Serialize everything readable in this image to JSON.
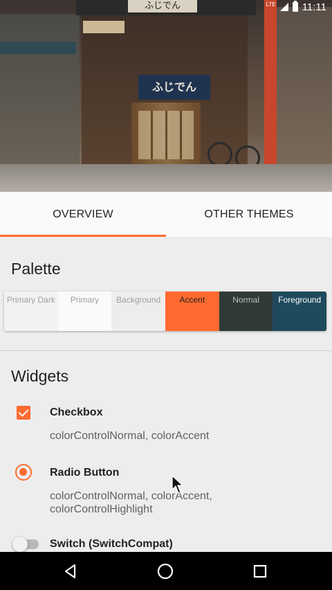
{
  "status_bar": {
    "network": "LTE",
    "time": "11:11"
  },
  "hero": {
    "shop_sign": "ふじでん",
    "noren_text": "ふじでん"
  },
  "tabs": [
    {
      "label": "OVERVIEW",
      "active": true
    },
    {
      "label": "OTHER THEMES",
      "active": false
    }
  ],
  "palette": {
    "title": "Palette",
    "swatches": [
      {
        "label": "Primary Dark",
        "bg": "#f2f2f2",
        "fg": "#9e9e9e"
      },
      {
        "label": "Primary",
        "bg": "#fafafa",
        "fg": "#9e9e9e"
      },
      {
        "label": "Background",
        "bg": "#ededed",
        "fg": "#9e9e9e"
      },
      {
        "label": "Accent",
        "bg": "#ff6a30",
        "fg": "#212121"
      },
      {
        "label": "Normal",
        "bg": "#2f3a38",
        "fg": "#bdbdbd"
      },
      {
        "label": "Foreground",
        "bg": "#1f4a5e",
        "fg": "#ffffff"
      }
    ]
  },
  "widgets": {
    "title": "Widgets",
    "checkbox": {
      "label": "Checkbox",
      "desc": "colorControlNormal, colorAccent",
      "checked": true
    },
    "radio": {
      "label": "Radio Button",
      "desc": "colorControlNormal, colorAccent, colorControlHighlight",
      "selected": true
    },
    "switch": {
      "label": "Switch (SwitchCompat)",
      "on": false
    }
  },
  "colors": {
    "accent": "#ff6a30"
  },
  "navbar": {
    "back": "back-icon",
    "home": "home-icon",
    "recents": "recents-icon"
  }
}
